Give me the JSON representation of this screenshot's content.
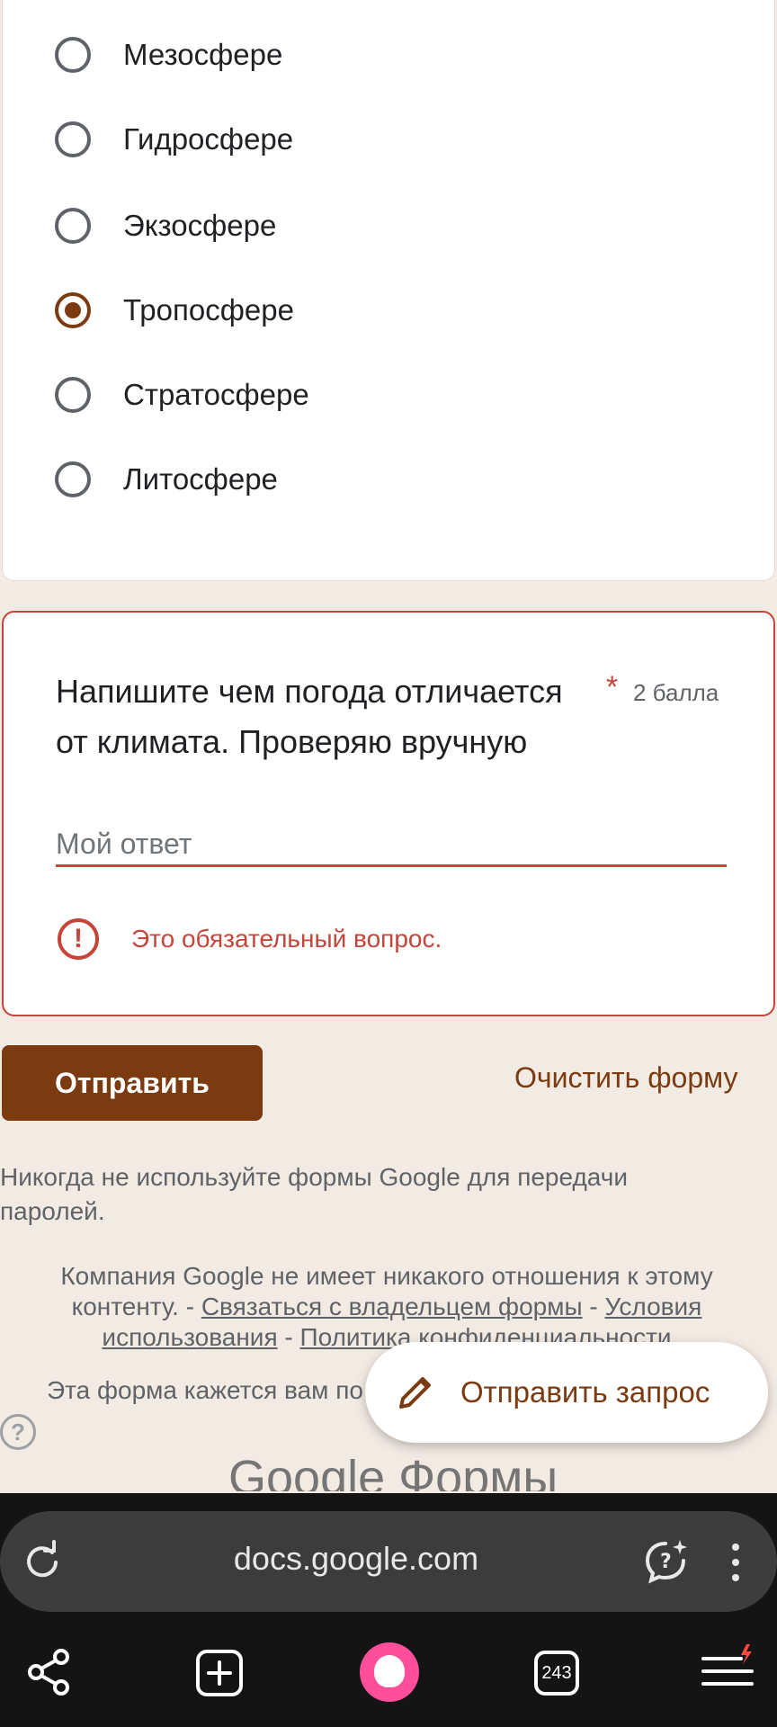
{
  "options": [
    {
      "label": "Мезосфере",
      "checked": false
    },
    {
      "label": "Гидросфере",
      "checked": false
    },
    {
      "label": "Экзосфере",
      "checked": false
    },
    {
      "label": "Тропосфере",
      "checked": true
    },
    {
      "label": "Стратосфере",
      "checked": false
    },
    {
      "label": "Литосфере",
      "checked": false
    }
  ],
  "question": {
    "title": "Напишите чем погода отличается от климата. Проверяю вручную",
    "required_mark": "*",
    "points": "2 балла",
    "placeholder": "Мой ответ",
    "error": "Это обязательный вопрос."
  },
  "actions": {
    "submit": "Отправить",
    "clear": "Очистить форму"
  },
  "footer": {
    "warning": "Никогда не используйте формы Google для передачи паролей.",
    "disclaimer_prefix": "Компания Google не имеет никакого отношения к этому контенту. - ",
    "contact_owner": "Связаться с владельцем формы",
    "separator": " - ",
    "terms": "Условия использования",
    "privacy": "Политика конфиденциальности",
    "abuse_text": "Эта форма кажется вам по",
    "brand": "Google Формы"
  },
  "fab": {
    "label": "Отправить запрос",
    "icon": "pencil-icon"
  },
  "browser": {
    "url": "docs.google.com",
    "tab_count": "243"
  },
  "colors": {
    "accent": "#7b3a10",
    "error": "#c5453a",
    "background": "#f2ebe3"
  }
}
